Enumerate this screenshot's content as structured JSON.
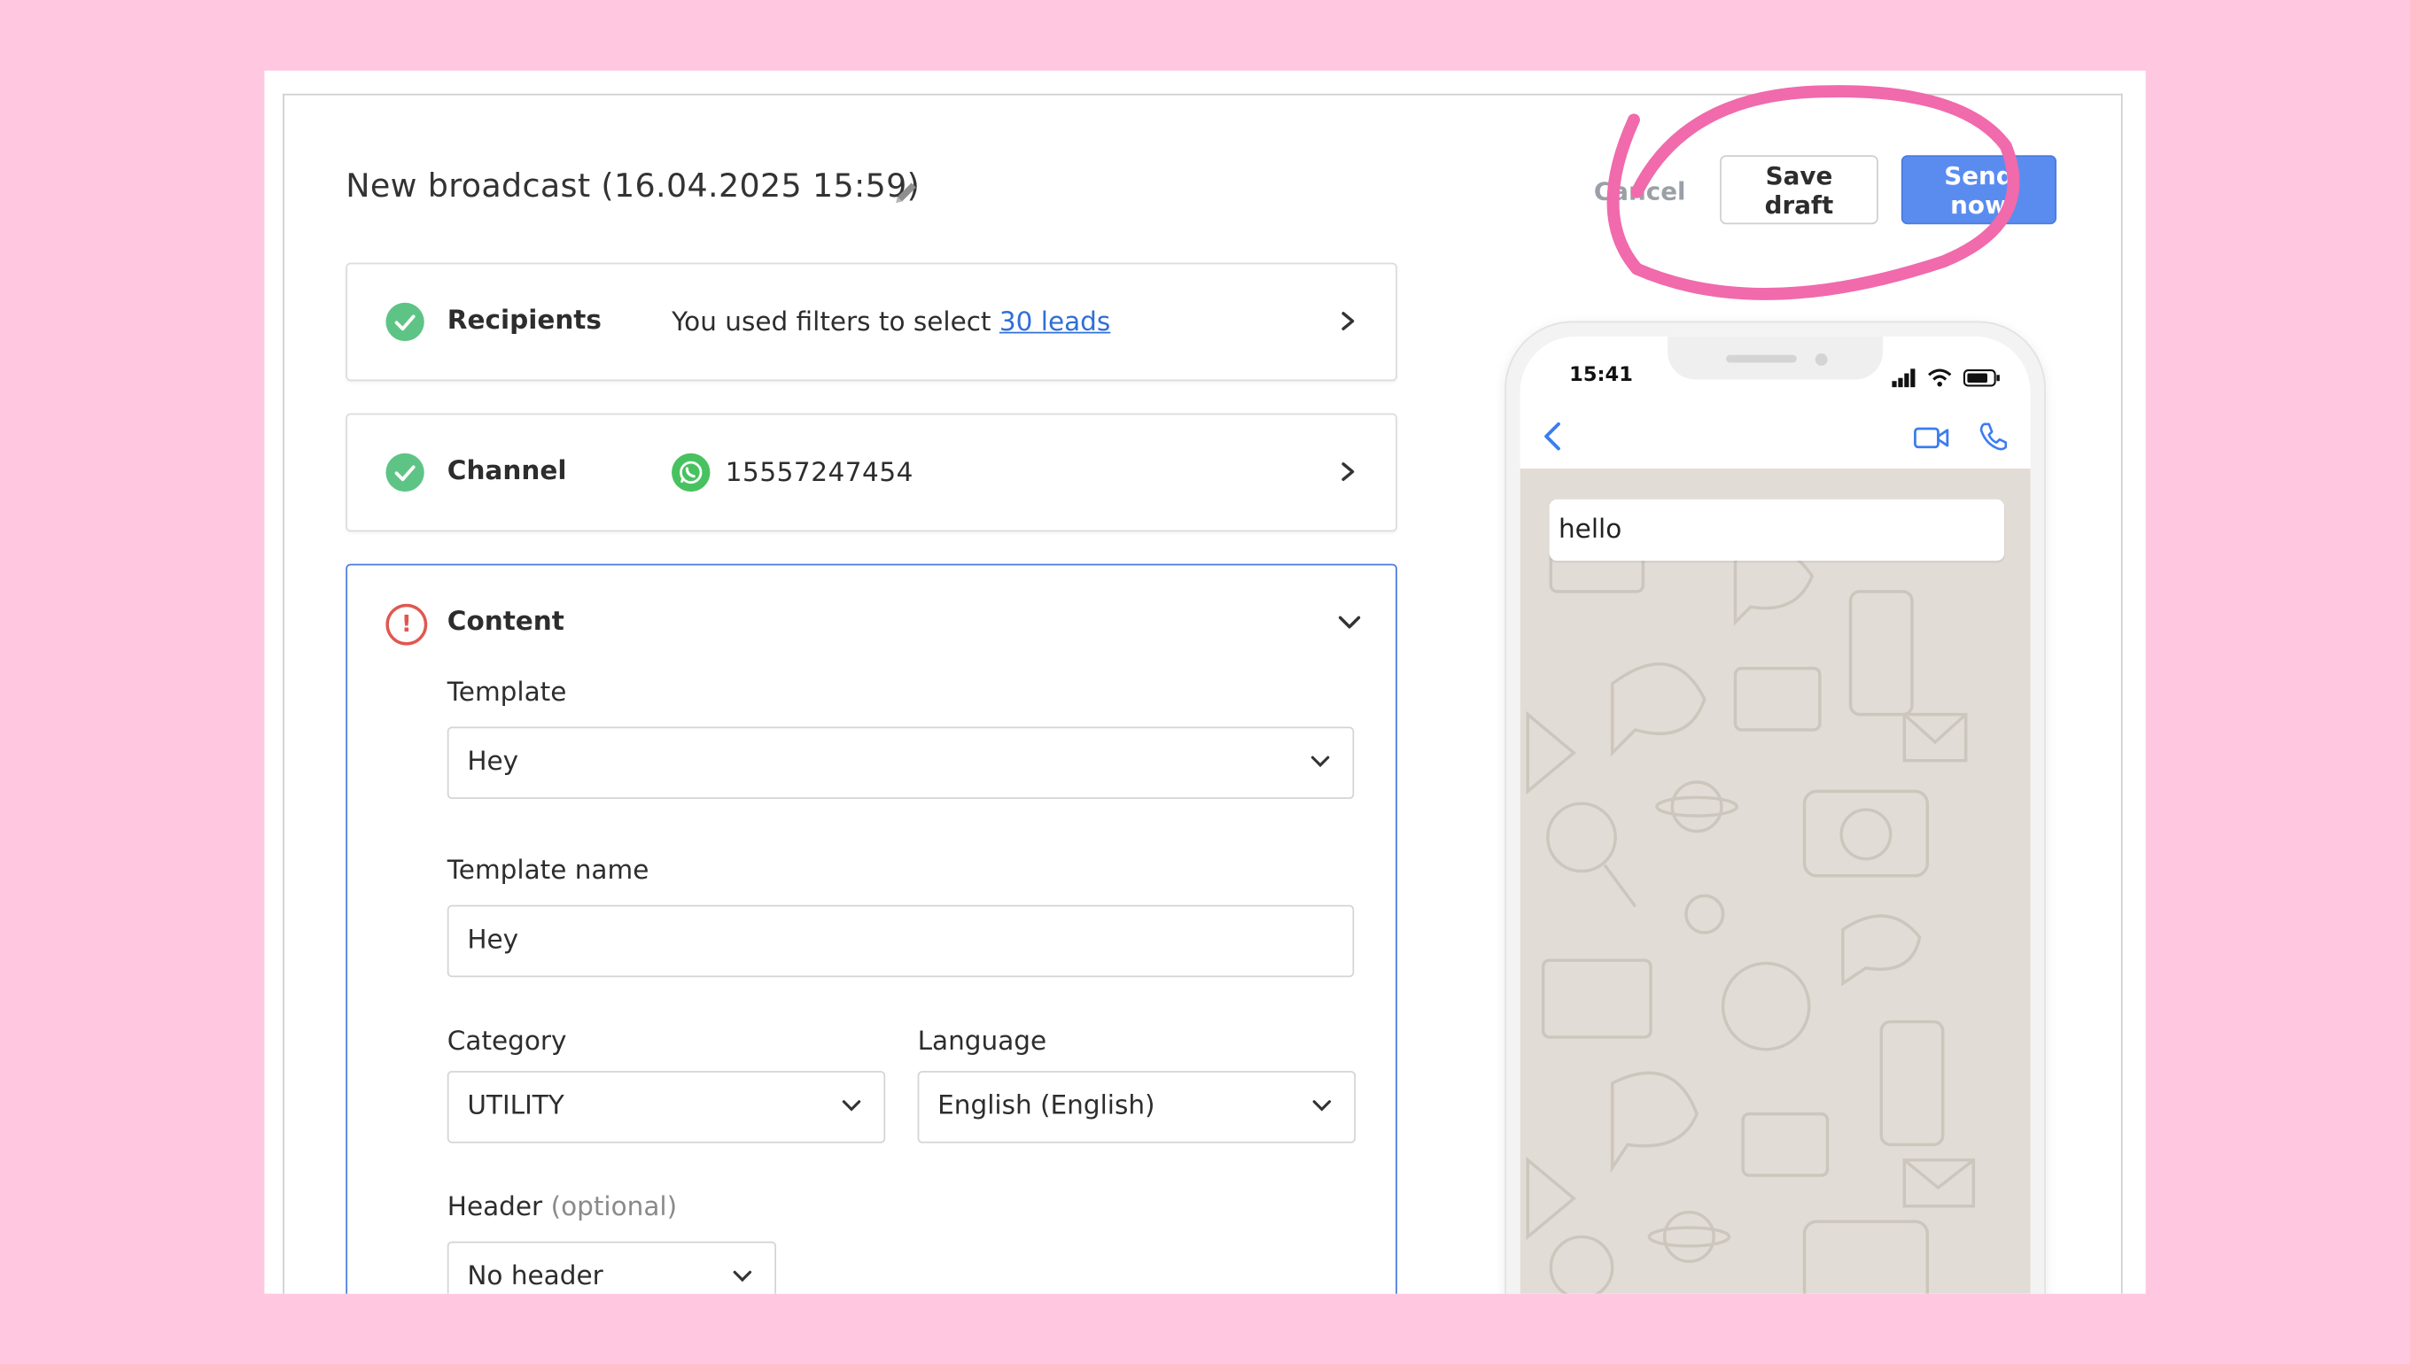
{
  "header": {
    "title": "New broadcast (16.04.2025 15:59)",
    "cancel_label": "Cancel",
    "save_draft_label": "Save draft",
    "send_now_label": "Send now"
  },
  "recipients": {
    "label": "Recipients",
    "description": "You used filters to select ",
    "leads_link": "30 leads"
  },
  "channel": {
    "label": "Channel",
    "number": "15557247454"
  },
  "content": {
    "label": "Content",
    "template_label": "Template",
    "template_value": "Hey",
    "template_name_label": "Template name",
    "template_name_value": "Hey",
    "category_label": "Category",
    "category_value": "UTILITY",
    "language_label": "Language",
    "language_value": "English (English)",
    "header_label": "Header",
    "header_optional": "(optional)",
    "header_value": "No header"
  },
  "preview": {
    "time": "15:41",
    "message": "hello"
  },
  "colors": {
    "page_background": "#ffc8e0",
    "accent_blue": "#5a8cf0",
    "success_green": "#5ec486",
    "error_red": "#e0574f",
    "marker_pink": "#f06aac",
    "whatsapp_green": "#48c260",
    "chat_background": "#e1dcd5"
  }
}
